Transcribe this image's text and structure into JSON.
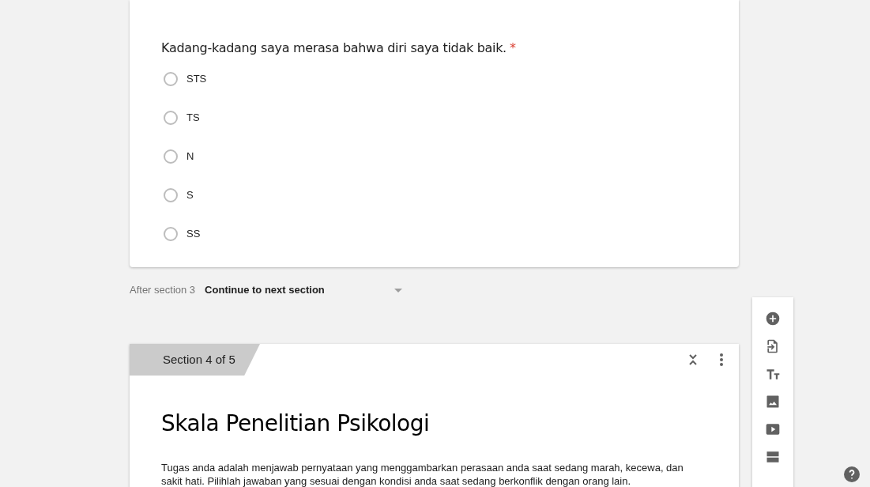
{
  "question": {
    "text": "Kadang-kadang saya merasa bahwa diri saya tidak baik.",
    "required_mark": "*",
    "options": [
      {
        "label": "STS",
        "selected": false
      },
      {
        "label": "TS",
        "selected": false
      },
      {
        "label": "N",
        "selected": false
      },
      {
        "label": "S",
        "selected": false
      },
      {
        "label": "SS",
        "selected": false
      }
    ]
  },
  "after_section": {
    "label": "After section 3",
    "value": "Continue to next section"
  },
  "section": {
    "tab": "Section 4 of 5",
    "title": "Skala Penelitian Psikologi",
    "description": "Tugas anda adalah menjawab pernyataan yang menggambarkan perasaan anda saat sedang marah, kecewa, dan sakit hati. Pilihlah jawaban yang sesuai dengan kondisi anda saat sedang berkonflik dengan orang lain."
  }
}
